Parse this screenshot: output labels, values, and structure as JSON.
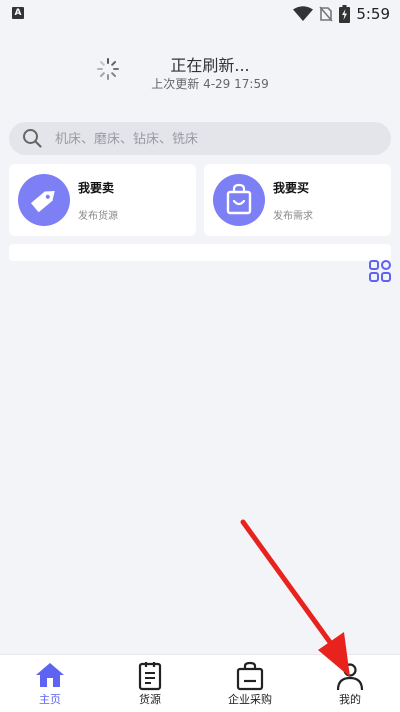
{
  "status_bar": {
    "badge": "A",
    "time": "5:59",
    "icons": [
      "wifi-icon",
      "no-sim-icon",
      "battery-charging-icon"
    ]
  },
  "refresh": {
    "title": "正在刷新...",
    "last_update": "上次更新 4-29 17:59",
    "icon": "spinner-icon"
  },
  "search": {
    "placeholder": "机床、磨床、钻床、铣床",
    "icon": "search-icon"
  },
  "cards": {
    "sell": {
      "title": "我要卖",
      "subtitle": "发布货源",
      "icon": "price-tag-icon"
    },
    "buy": {
      "title": "我要买",
      "subtitle": "发布需求",
      "icon": "shopping-bag-icon"
    }
  },
  "grid_icon": "grid-menu-icon",
  "colors": {
    "accent": "#5f63f2",
    "card_icon_bg": "#7d80f5",
    "arrow": "#e8231e"
  },
  "bottom_nav": [
    {
      "label": "主页",
      "icon": "home-icon",
      "active": true
    },
    {
      "label": "货源",
      "icon": "document-list-icon",
      "active": false
    },
    {
      "label": "企业采购",
      "icon": "shopping-bag-icon",
      "active": false
    },
    {
      "label": "我的",
      "icon": "user-icon",
      "active": false
    }
  ]
}
